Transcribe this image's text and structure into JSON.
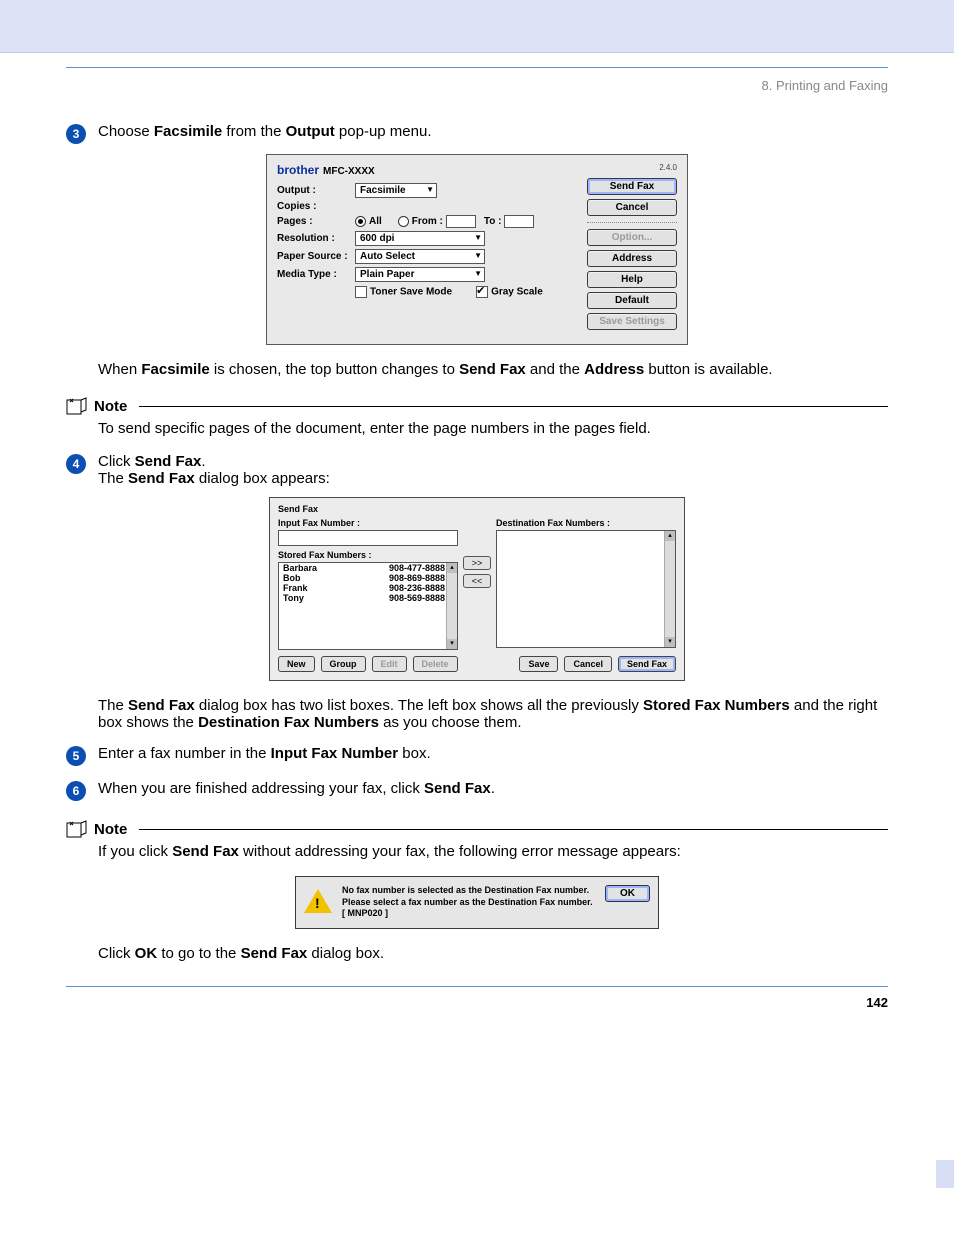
{
  "breadcrumb": "8. Printing and Faxing",
  "page_number": "142",
  "steps": {
    "s3": {
      "num": "3",
      "pre": "Choose ",
      "b1": "Facsimile",
      "mid": " from the ",
      "b2": "Output",
      "post": " pop-up menu."
    },
    "s3_after": {
      "pre": "When ",
      "b1": "Facsimile",
      "mid": " is chosen, the top button changes to ",
      "b2": "Send Fax",
      "mid2": " and the ",
      "b3": "Address",
      "post": " button is available."
    },
    "s4": {
      "num": "4",
      "l1_pre": "Click ",
      "l1_b": "Send Fax",
      "l1_post": ".",
      "l2_pre": "The ",
      "l2_b": "Send Fax",
      "l2_post": " dialog box appears:"
    },
    "s4_after": {
      "pre": "The ",
      "b1": "Send Fax",
      "mid1": " dialog box has two list boxes. The left box shows all the previously ",
      "b2": "Stored Fax Numbers",
      "mid2": " and the right box shows the ",
      "b3": "Destination Fax Numbers",
      "post": " as you choose them."
    },
    "s5": {
      "num": "5",
      "pre": "Enter a fax number in the ",
      "b1": "Input Fax Number",
      "post": " box."
    },
    "s6": {
      "num": "6",
      "pre": "When you are finished addressing your fax, click ",
      "b1": "Send Fax",
      "post": "."
    },
    "final": {
      "pre": "Click ",
      "b1": "OK",
      "mid": " to go to the ",
      "b2": "Send Fax",
      "post": " dialog box."
    }
  },
  "notes": {
    "label": "Note",
    "n1": "To send specific pages of the document, enter the page numbers in the pages field.",
    "n2_pre": "If you click ",
    "n2_b": "Send Fax",
    "n2_post": " without addressing your fax, the following error message appears:"
  },
  "dlg1": {
    "brand": "brother",
    "model": "MFC-XXXX",
    "version": "2.4.0",
    "labels": {
      "output": "Output :",
      "copies": "Copies :",
      "pages": "Pages :",
      "all": "All",
      "from": "From :",
      "to": "To :",
      "resolution": "Resolution :",
      "paper": "Paper Source :",
      "media": "Media Type :",
      "toner": "Toner Save Mode",
      "gray": "Gray Scale"
    },
    "values": {
      "output": "Facsimile",
      "resolution": "600 dpi",
      "paper": "Auto Select",
      "media": "Plain Paper"
    },
    "buttons": {
      "send": "Send Fax",
      "cancel": "Cancel",
      "option": "Option...",
      "address": "Address",
      "help": "Help",
      "default": "Default",
      "save": "Save Settings"
    }
  },
  "dlg2": {
    "title": "Send Fax",
    "labels": {
      "input": "Input Fax Number :",
      "stored": "Stored Fax Numbers :",
      "dest": "Destination Fax Numbers :"
    },
    "stored": [
      {
        "name": "Barbara",
        "num": "908-477-8888"
      },
      {
        "name": "Bob",
        "num": "908-869-8888"
      },
      {
        "name": "Frank",
        "num": "908-236-8888"
      },
      {
        "name": "Tony",
        "num": "908-569-8888"
      }
    ],
    "arrows": {
      "add": ">>",
      "rem": "<<"
    },
    "buttons": {
      "new": "New",
      "group": "Group",
      "edit": "Edit",
      "delete": "Delete",
      "save": "Save",
      "cancel": "Cancel",
      "send": "Send Fax"
    }
  },
  "dlg3": {
    "l1": "No fax number is selected as the Destination Fax number.",
    "l2": "Please select a fax number as the Destination Fax number.",
    "l3": "[ MNP020 ]",
    "ok": "OK"
  }
}
